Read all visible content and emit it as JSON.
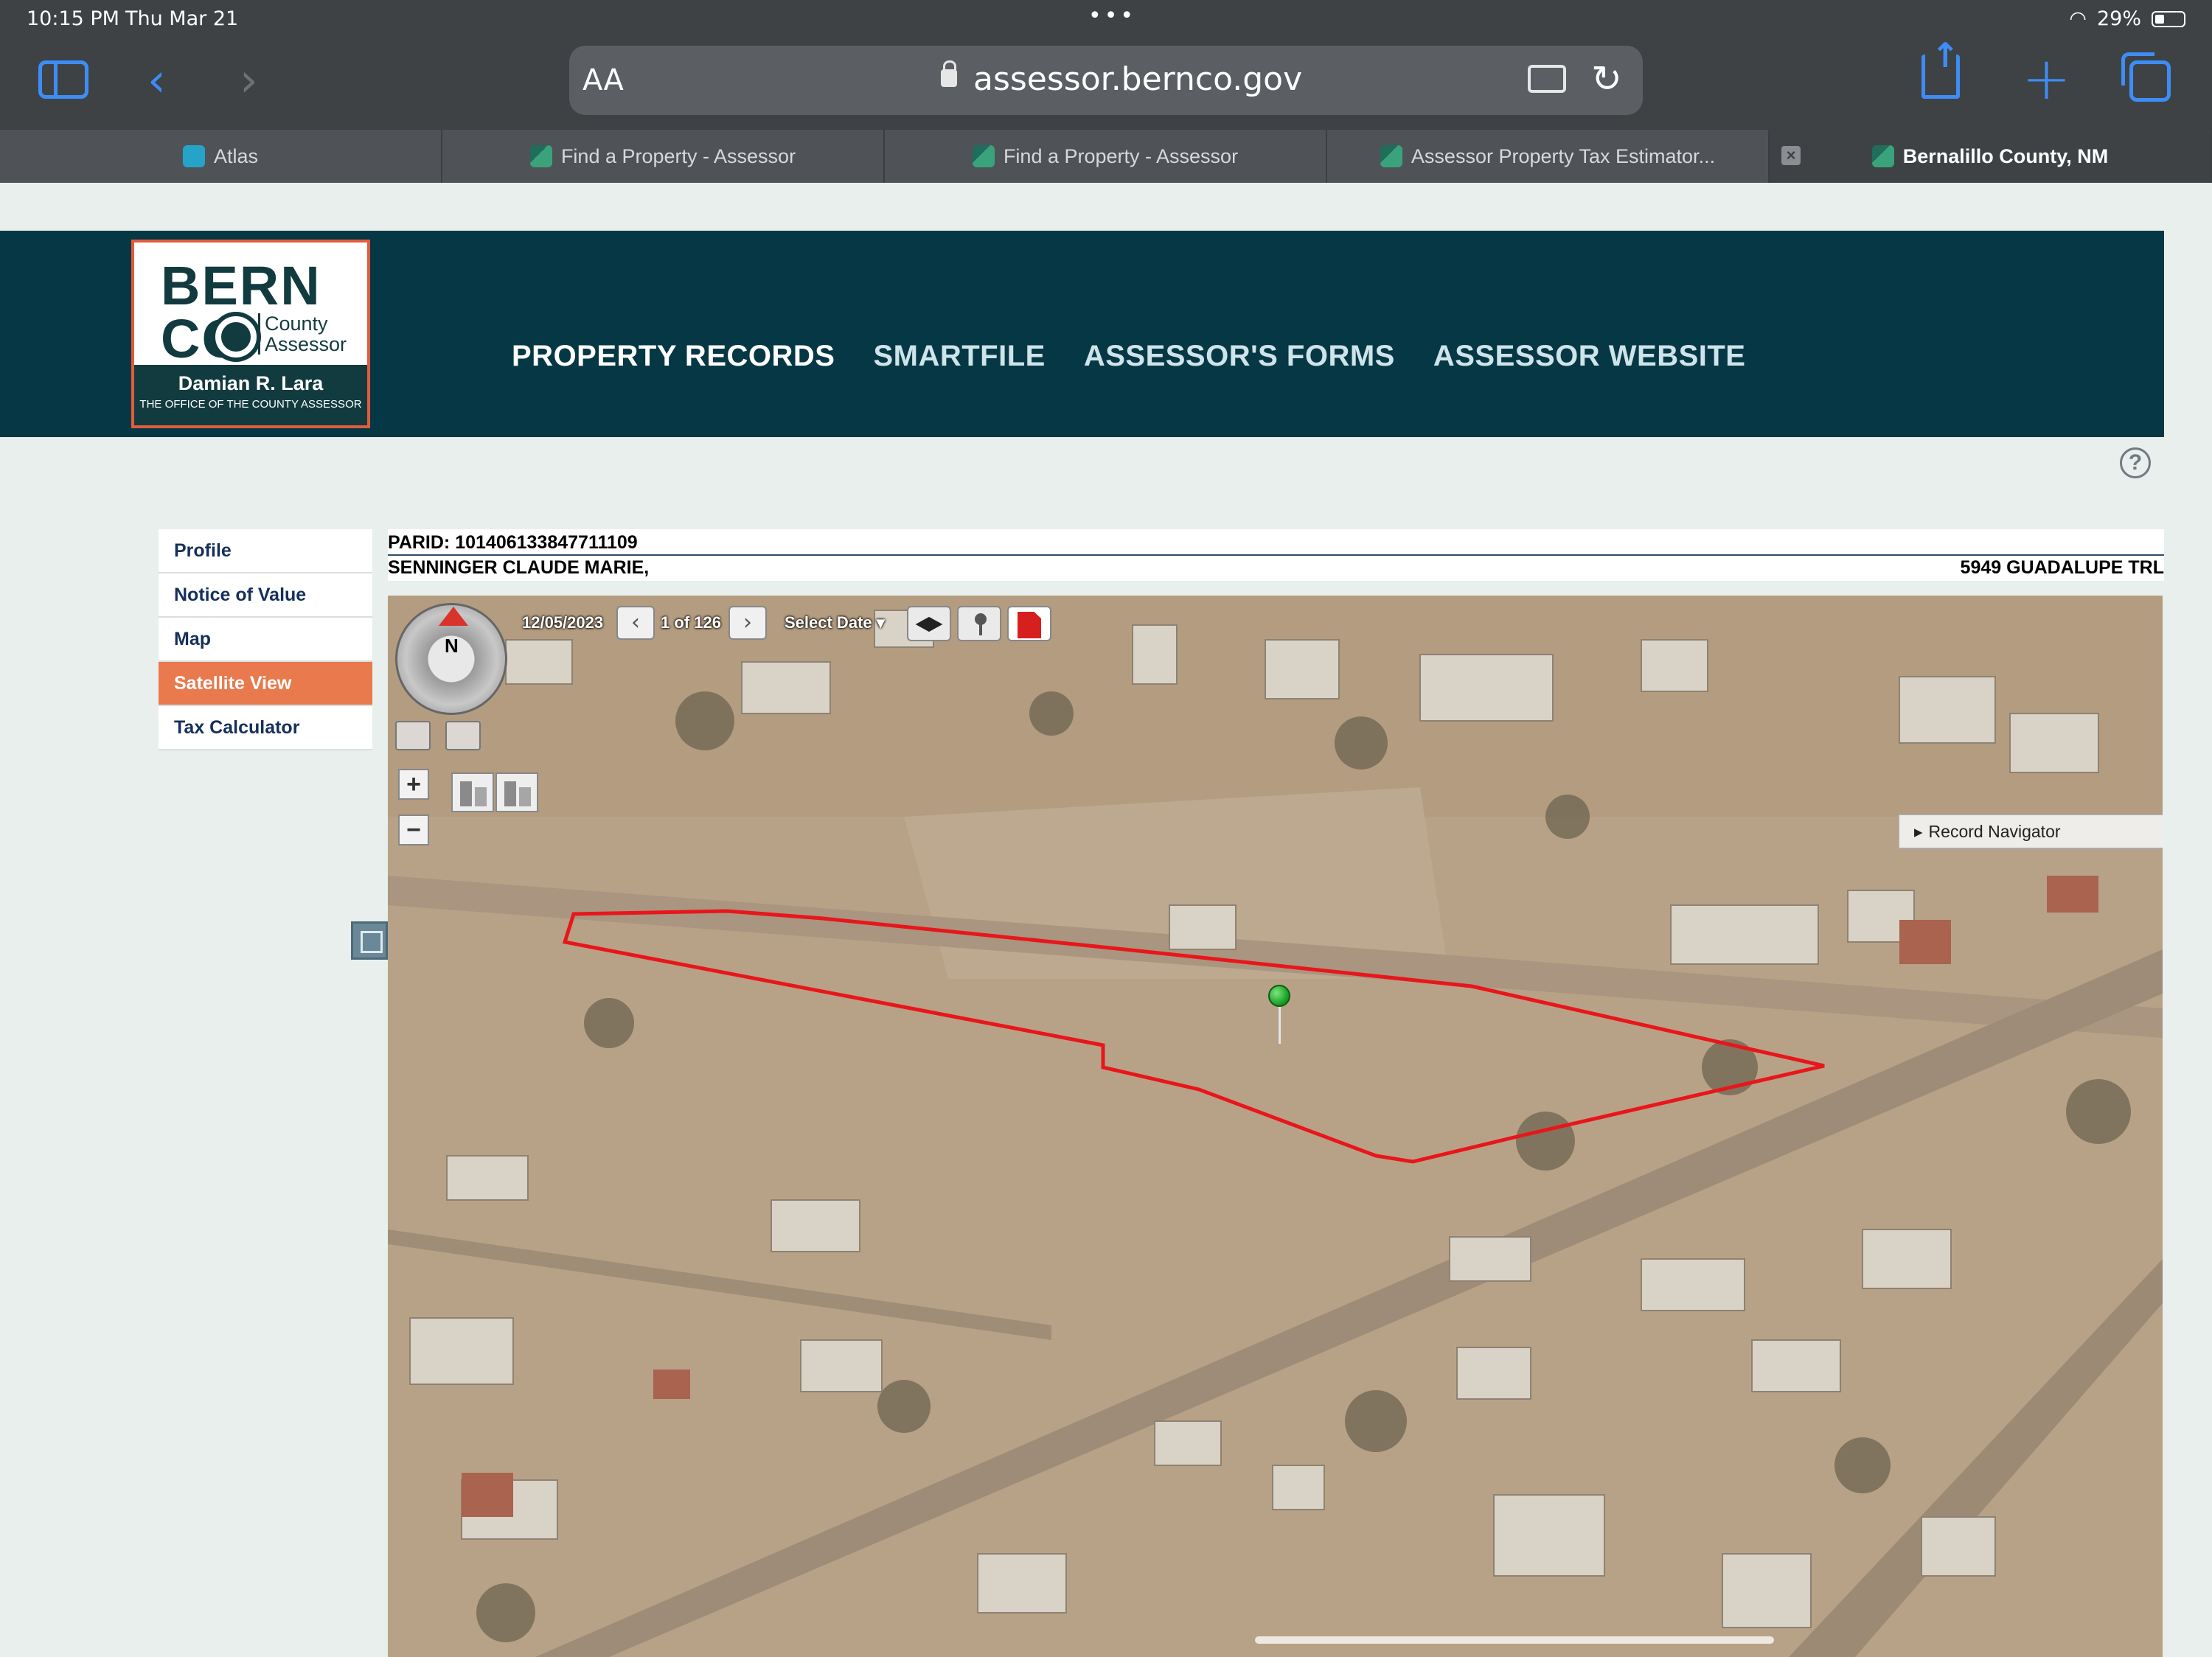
{
  "status_bar": {
    "time": "10:15 PM",
    "date": "Thu Mar 21",
    "battery": "29%"
  },
  "browser": {
    "aa_label": "AA",
    "url": "assessor.bernco.gov",
    "tabs": [
      {
        "label": "Atlas",
        "favicon": "atlas-icon"
      },
      {
        "label": "Find a Property - Assessor",
        "favicon": "bernco-icon"
      },
      {
        "label": "Find a Property - Assessor",
        "favicon": "bernco-icon"
      },
      {
        "label": "Assessor Property Tax Estimator...",
        "favicon": "bernco-icon"
      },
      {
        "label": "Bernalillo County, NM",
        "favicon": "bernco-icon",
        "active": true
      }
    ]
  },
  "header": {
    "logo": {
      "line1": "BERN",
      "line2": "CO",
      "county": "County",
      "assessor": "Assessor",
      "name": "Damian R. Lara",
      "subtitle": "THE OFFICE OF THE COUNTY ASSESSOR"
    },
    "nav": [
      "PROPERTY RECORDS",
      "SMARTFILE",
      "ASSESSOR'S FORMS",
      "ASSESSOR WEBSITE"
    ],
    "help_label": "?"
  },
  "sidemenu": {
    "items": [
      "Profile",
      "Notice of Value",
      "Map",
      "Satellite View",
      "Tax Calculator"
    ],
    "active": "Satellite View"
  },
  "parcel": {
    "parid": "PARID: 101406133847711109",
    "owner": "SENNINGER CLAUDE MARIE,",
    "address": "5949 GUADALUPE TRL"
  },
  "map": {
    "date": "12/05/2023",
    "image_index": "1 of 126",
    "select_date": "Select Date",
    "compass_label": "N",
    "zoom_in": "+",
    "zoom_out": "−",
    "record_navigator": "Record Navigator",
    "prev_arrow": "‹",
    "next_arrow": "›"
  },
  "colors": {
    "header_bg": "#053844",
    "menu_active": "#e87a4e",
    "logo_accent": "#e35b3a",
    "parcel_outline": "#e8161b",
    "browser_accent": "#3d8df5"
  }
}
